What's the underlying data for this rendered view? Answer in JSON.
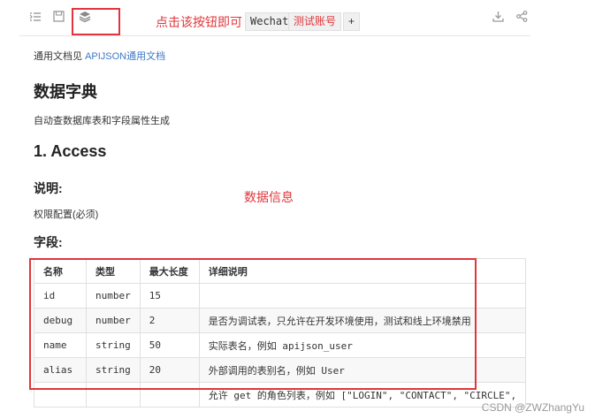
{
  "toolbar": {
    "icons": [
      "list-indent-icon",
      "save-icon",
      "layers-icon",
      "download-icon",
      "share-icon"
    ],
    "annotation": "点击该按钮即可",
    "env_label": "Wechat",
    "account_label": "测试账号",
    "add_label": "+"
  },
  "doc": {
    "intro_prefix": "通用文档见",
    "intro_link": "APIJSON通用文档",
    "title": "数据字典",
    "subtitle": "自动查数据库表和字段属性生成",
    "section_title": "1. Access",
    "explain_heading": "说明:",
    "explain_text": "权限配置(必须)",
    "fields_heading": "字段:",
    "data_annotation": "数据信息"
  },
  "table": {
    "headers": [
      "名称",
      "类型",
      "最大长度",
      "详细说明"
    ],
    "rows": [
      [
        "id",
        "number",
        "15",
        ""
      ],
      [
        "debug",
        "number",
        "2",
        "是否为调试表，只允许在开发环境使用，测试和线上环境禁用"
      ],
      [
        "name",
        "string",
        "50",
        "实际表名，例如 apijson_user"
      ],
      [
        "alias",
        "string",
        "20",
        "外部调用的表别名，例如 User"
      ],
      [
        "",
        "",
        "",
        "允许 get 的角色列表，例如 [\"LOGIN\", \"CONTACT\", \"CIRCLE\","
      ]
    ]
  },
  "watermark": "CSDN @ZWZhangYu",
  "colors": {
    "annotation": "#e0363b",
    "link": "#3c78c6"
  }
}
